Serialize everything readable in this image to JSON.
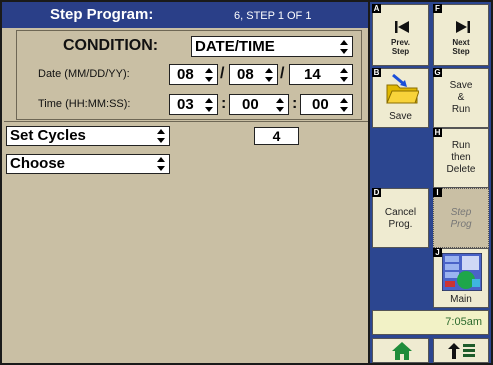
{
  "header": {
    "title": "Step Program:",
    "step_info": "6, STEP  1  OF  1"
  },
  "condition": {
    "label": "CONDITION:",
    "value": "DATE/TIME"
  },
  "date": {
    "label": "Date (MM/DD/YY):",
    "month": "08",
    "day": "08",
    "year": "14",
    "sep": "/"
  },
  "time": {
    "label": "Time (HH:MM:SS):",
    "hour": "03",
    "minute": "00",
    "second": "00",
    "sep": ":"
  },
  "action1": {
    "value": "Set Cycles",
    "count": "4"
  },
  "action2": {
    "value": "Choose"
  },
  "buttons": {
    "A": {
      "letter": "A",
      "line1": "Prev.",
      "line2": "Step"
    },
    "F": {
      "letter": "F",
      "line1": "Next",
      "line2": "Step"
    },
    "B": {
      "letter": "B",
      "label": "Save"
    },
    "G": {
      "letter": "G",
      "line1": "Save",
      "line2": "&",
      "line3": "Run"
    },
    "H": {
      "letter": "H",
      "line1": "Run",
      "line2": "then",
      "line3": "Delete"
    },
    "D": {
      "letter": "D",
      "line1": "Cancel",
      "line2": "Prog."
    },
    "I": {
      "letter": "I",
      "line1": "Step",
      "line2": "Prog"
    },
    "J": {
      "letter": "J",
      "label": "Main"
    }
  },
  "clock": "7:05am",
  "colors": {
    "header_bg": "#2a3f88",
    "panel_bg": "#c9bfa4",
    "button_bg": "#efebd1",
    "clock_bg": "#f2f2c6",
    "accent_blue": "#2c4690"
  }
}
